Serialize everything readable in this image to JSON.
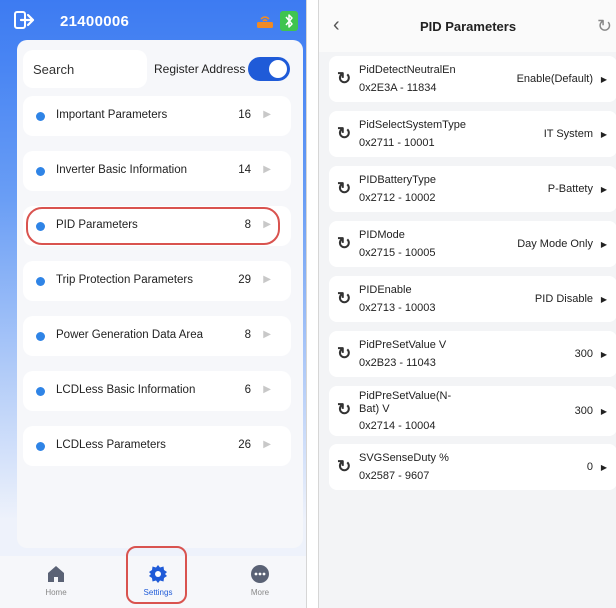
{
  "left": {
    "device_id": "21400006",
    "search_placeholder": "Search",
    "register_address_label": "Register Address",
    "register_address_on": true,
    "categories": [
      {
        "label": "Important Parameters",
        "count": "16"
      },
      {
        "label": "Inverter Basic Information",
        "count": "14"
      },
      {
        "label": "PID Parameters",
        "count": "8"
      },
      {
        "label": "Trip Protection Parameters",
        "count": "29"
      },
      {
        "label": "Power Generation Data Area",
        "count": "8"
      },
      {
        "label": "LCDLess Basic Information",
        "count": "6"
      },
      {
        "label": "LCDLess Parameters",
        "count": "26"
      }
    ],
    "tabs": [
      {
        "label": "Home",
        "icon": "home-icon"
      },
      {
        "label": "Settings",
        "icon": "gear-icon"
      },
      {
        "label": "More",
        "icon": "more-icon"
      }
    ],
    "active_tab": "Settings"
  },
  "right": {
    "title": "PID Parameters",
    "params": [
      {
        "name": "PidDetectNeutralEn",
        "address": "0x2E3A - 11834",
        "value": "Enable(Default)"
      },
      {
        "name": "PidSelectSystemType",
        "address": "0x2711 - 10001",
        "value": "IT System"
      },
      {
        "name": "PIDBatteryType",
        "address": "0x2712 - 10002",
        "value": "P-Battety"
      },
      {
        "name": "PIDMode",
        "address": "0x2715 - 10005",
        "value": "Day Mode Only"
      },
      {
        "name": "PIDEnable",
        "address": "0x2713 - 10003",
        "value": "PID Disable"
      },
      {
        "name": "PidPreSetValue V",
        "address": "0x2B23 - 11043",
        "value": "300"
      },
      {
        "name": "PidPreSetValue(N-\nBat) V",
        "address": "0x2714 - 10004",
        "value": "300"
      },
      {
        "name": "SVGSenseDuty %",
        "address": "0x2587 - 9607",
        "value": "0"
      }
    ]
  },
  "colors": {
    "accent": "#1f5bd8",
    "dot": "#2f84e6",
    "highlight": "#d9534f",
    "bluetooth": "#3fc44f"
  }
}
